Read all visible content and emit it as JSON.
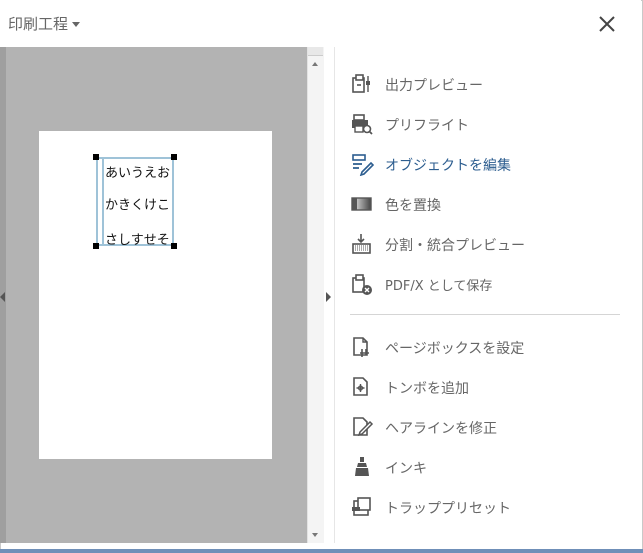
{
  "header": {
    "title": "印刷工程"
  },
  "document": {
    "lines": [
      "あいうえお",
      "かきくけこ",
      "さしすせそ"
    ]
  },
  "tools": {
    "group1": [
      {
        "label": "出力プレビュー",
        "icon": "output-preview-icon"
      },
      {
        "label": "プリフライト",
        "icon": "preflight-icon"
      },
      {
        "label": "オブジェクトを編集",
        "icon": "edit-object-icon",
        "active": true
      },
      {
        "label": "色を置換",
        "icon": "replace-color-icon"
      },
      {
        "label": "分割・統合プレビュー",
        "icon": "flattener-preview-icon"
      },
      {
        "label": "PDF/X として保存",
        "icon": "save-pdfx-icon"
      }
    ],
    "group2": [
      {
        "label": "ページボックスを設定",
        "icon": "set-page-box-icon"
      },
      {
        "label": "トンボを追加",
        "icon": "add-printer-marks-icon"
      },
      {
        "label": "ヘアラインを修正",
        "icon": "fix-hairlines-icon"
      },
      {
        "label": "インキ",
        "icon": "ink-icon"
      },
      {
        "label": "トラッププリセット",
        "icon": "trap-presets-icon"
      }
    ]
  },
  "colors": {
    "active_label": "#2c5d8f",
    "canvas_bg": "#b3b3b3",
    "selection": "#9fc3d8"
  }
}
